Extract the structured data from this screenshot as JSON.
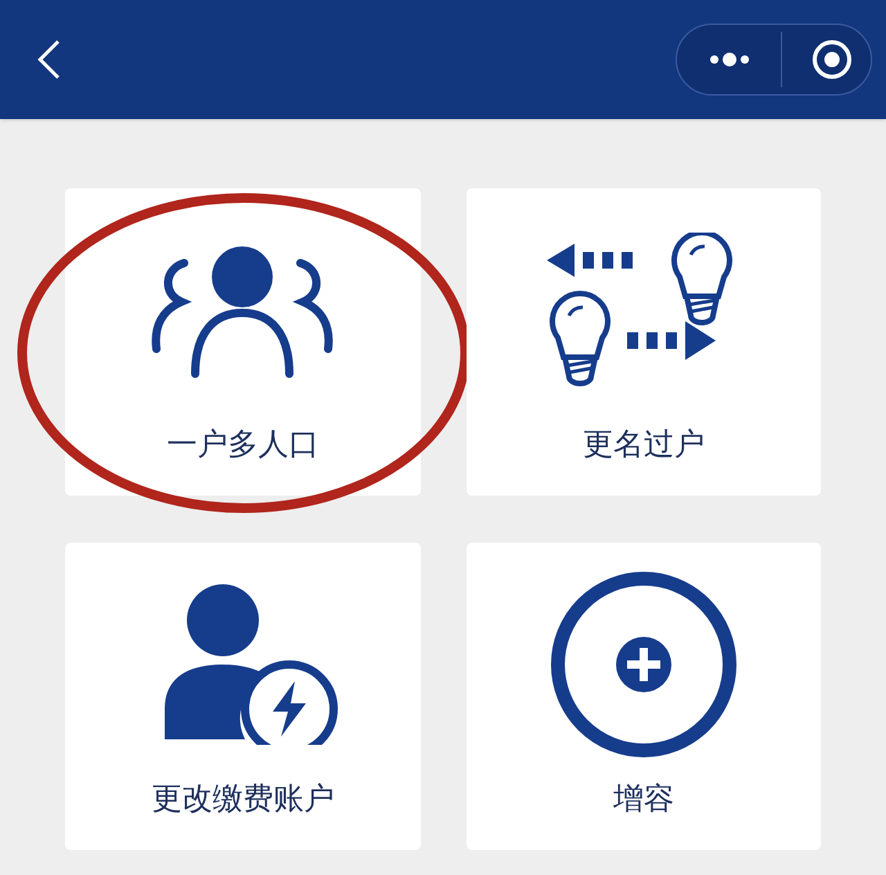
{
  "tiles": [
    {
      "kind": "people",
      "label": "一户多人口",
      "circled": true
    },
    {
      "kind": "transfer",
      "label": "更名过户",
      "circled": false
    },
    {
      "kind": "account",
      "label": "更改缴费账户",
      "circled": false
    },
    {
      "kind": "add",
      "label": "增容",
      "circled": false
    }
  ]
}
